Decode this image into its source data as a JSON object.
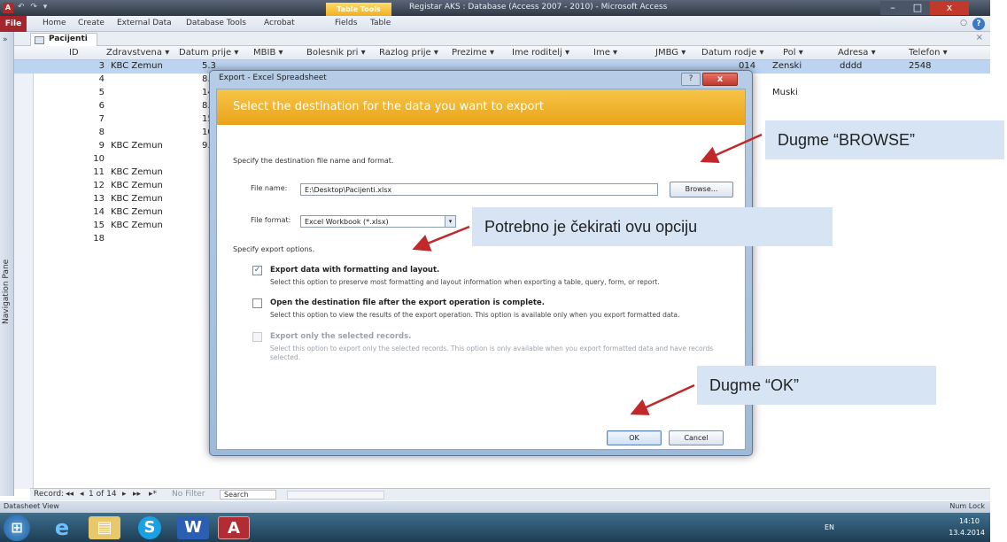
{
  "titlebar": {
    "app_icon": "A",
    "qat": "↶ ↷ ▾",
    "contextual_tab": "Table Tools",
    "title": "Registar AKS : Database (Access 2007 - 2010) - Microsoft Access",
    "min": "–",
    "max": "□",
    "close": "x"
  },
  "ribbon": {
    "file": "File",
    "tabs": [
      "Home",
      "Create",
      "External Data",
      "Database Tools",
      "Acrobat",
      "Fields",
      "Table"
    ],
    "help": "?"
  },
  "nav_pane": {
    "chevron": "»",
    "label": "Navigation Pane"
  },
  "doc_tab": {
    "label": "Pacijenti",
    "close": "×"
  },
  "grid": {
    "headers": [
      "ID",
      "Zdravstvena ▾",
      "Datum prije ▾",
      "MBIB ▾",
      "Bolesnik pri ▾",
      "Razlog prije ▾",
      "Prezime ▾",
      "Ime roditelj ▾",
      "Ime ▾",
      "JMBG ▾",
      "Datum rodje ▾",
      "Pol ▾",
      "Adresa ▾",
      "Telefon ▾"
    ],
    "rows": [
      {
        "id": "3",
        "zd": "KBC Zemun",
        "dp": "5.3",
        "dr": "014",
        "pol": "Zenski",
        "adr": "dddd",
        "tel": "2548"
      },
      {
        "id": "4",
        "zd": "",
        "dp": "8.3",
        "dr": "",
        "pol": "",
        "adr": "",
        "tel": ""
      },
      {
        "id": "5",
        "zd": "",
        "dp": "14.3",
        "dr": "",
        "pol": "Muski",
        "adr": "",
        "tel": ""
      },
      {
        "id": "6",
        "zd": "",
        "dp": "8.3",
        "dr": "",
        "pol": "",
        "adr": "",
        "tel": ""
      },
      {
        "id": "7",
        "zd": "",
        "dp": "15.2",
        "dr": "",
        "pol": "",
        "adr": "",
        "tel": ""
      },
      {
        "id": "8",
        "zd": "",
        "dp": "10.4",
        "dr": "",
        "pol": "",
        "adr": "",
        "tel": ""
      },
      {
        "id": "9",
        "zd": "KBC Zemun",
        "dp": "9.3",
        "dr": "",
        "pol": "",
        "adr": "",
        "tel": ""
      },
      {
        "id": "10",
        "zd": "",
        "dp": "",
        "dr": "",
        "pol": "",
        "adr": "",
        "tel": ""
      },
      {
        "id": "11",
        "zd": "KBC Zemun",
        "dp": "",
        "dr": "",
        "pol": "",
        "adr": "",
        "tel": ""
      },
      {
        "id": "12",
        "zd": "KBC Zemun",
        "dp": "",
        "dr": "",
        "pol": "",
        "adr": "",
        "tel": ""
      },
      {
        "id": "13",
        "zd": "KBC Zemun",
        "dp": "",
        "dr": "",
        "pol": "",
        "adr": "",
        "tel": ""
      },
      {
        "id": "14",
        "zd": "KBC Zemun",
        "dp": "",
        "dr": "",
        "pol": "",
        "adr": "",
        "tel": ""
      },
      {
        "id": "15",
        "zd": "KBC Zemun",
        "dp": "",
        "dr": "",
        "pol": "",
        "adr": "",
        "tel": ""
      },
      {
        "id": "18",
        "zd": "",
        "dp": "",
        "dr": "",
        "pol": "",
        "adr": "",
        "tel": ""
      }
    ]
  },
  "record_nav": {
    "label": "Record:",
    "first": "◂◂",
    "prev": "◂",
    "position": "1 of 14",
    "next": "▸",
    "last": "▸▸",
    "new": "▸*",
    "filter": "No Filter",
    "search": "Search"
  },
  "statusbar": {
    "left": "Datasheet View",
    "right": "Num Lock"
  },
  "taskbar": {
    "start": "⊞",
    "ie": "e",
    "explorer": "▤",
    "skype": "S",
    "word": "W",
    "access": "A",
    "lang": "EN",
    "time": "14:10",
    "date": "13.4.2014"
  },
  "dialog": {
    "title": "Export - Excel Spreadsheet",
    "help": "?",
    "close": "x",
    "banner": "Select the destination for the data you want to export",
    "specify_dest": "Specify the destination file name and format.",
    "file_name_label": "File name:",
    "file_name_value": "E:\\Desktop\\Pacijenti.xlsx",
    "browse": "Browse...",
    "file_format_label": "File format:",
    "file_format_value": "Excel Workbook (*.xlsx)",
    "dropdown": "▾",
    "export_options": "Specify export options.",
    "opt1_label": "Export data with formatting and layout.",
    "opt1_desc": "Select this option to preserve most formatting and layout information when exporting a table, query, form, or report.",
    "opt1_checked": "✓",
    "opt2_label": "Open the destination file after the export operation is complete.",
    "opt2_desc": "Select this option to view the results of the export operation. This option is available only when you export formatted data.",
    "opt3_label": "Export only the selected records.",
    "opt3_desc": "Select this option to export only the selected records. This option is only available when you export formatted data and have records",
    "opt3_desc2": "selected.",
    "ok": "OK",
    "cancel": "Cancel"
  },
  "annotations": {
    "browse": "Dugme “BROWSE”",
    "option": "Potrebno je čekirati ovu opciju",
    "ok": "Dugme “OK”",
    "arrow_color": "#c0282a"
  }
}
